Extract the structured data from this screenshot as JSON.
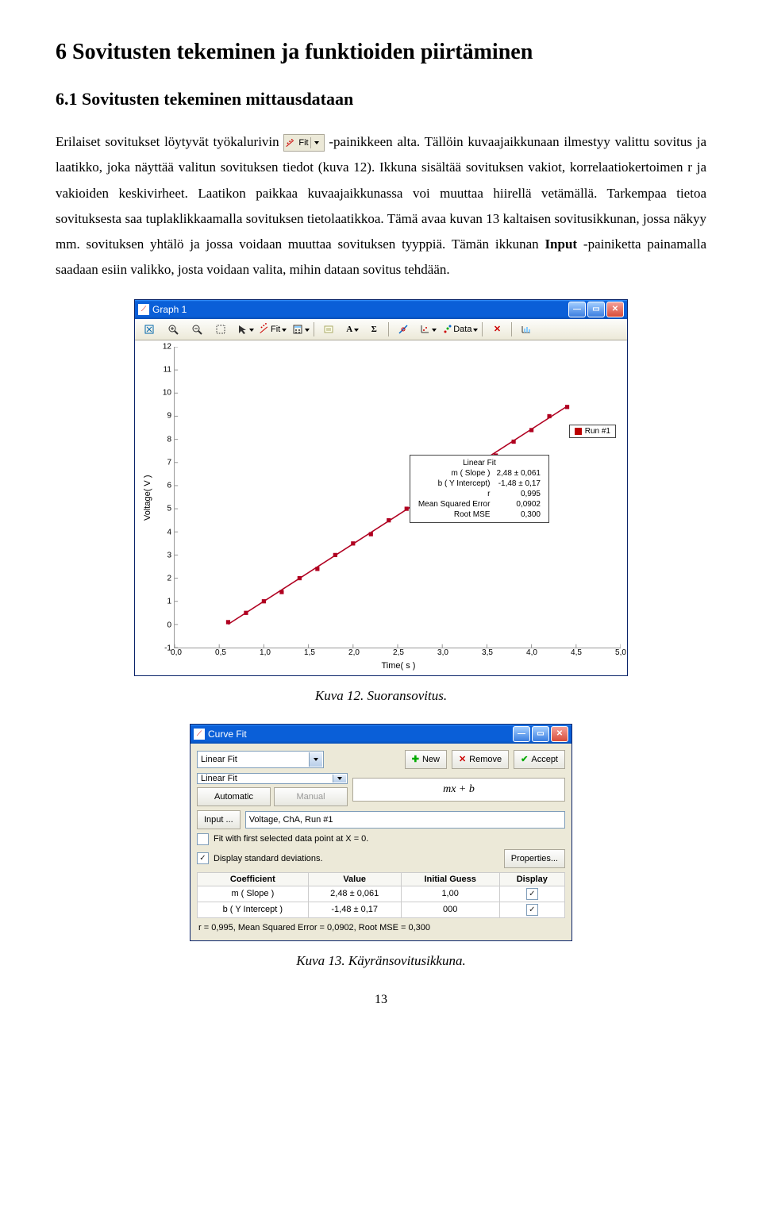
{
  "heading1": "6  Sovitusten tekeminen ja funktioiden piirtäminen",
  "heading2": "6.1  Sovitusten tekeminen mittausdataan",
  "para1a": "Erilaiset sovitukset löytyvät työkalurivin ",
  "fit_btn_label": "Fit",
  "para1b": "-painikkeen alta. Tällöin kuvaajaikkunaan ilmestyy valittu sovitus ja laatikko, joka näyttää valitun sovituksen tiedot (kuva 12). Ikkuna sisältää sovituksen vakiot, korrelaatiokertoimen r ja vakioiden keskivirheet. Laatikon paikkaa kuvaajaikkunassa voi muuttaa hiirellä vetämällä. Tarkempaa tietoa sovituksesta saa tuplaklikkaamalla sovituksen tietolaatikkoa. Tämä avaa kuvan 13 kaltaisen sovitusikkunan, jossa näkyy mm. sovituksen yhtälö ja jossa voidaan muuttaa sovituksen tyyppiä. Tämän ikkunan ",
  "input_bold": "Input",
  "para1c": "-painiketta painamalla saadaan esiin valikko, josta voidaan valita, mihin dataan sovitus tehdään.",
  "graph": {
    "title": "Graph 1",
    "toolbar": {
      "fit_label": "Fit",
      "data_label": "Data"
    },
    "ylabel": "Voltage( V )",
    "xlabel": "Time( s )",
    "legend": "Run #1",
    "info": {
      "title": "Linear Fit",
      "rows": [
        [
          "m ( Slope )",
          "2,48 ± 0,061"
        ],
        [
          "b ( Y Intercept)",
          "-1,48 ±  0,17"
        ],
        [
          "r",
          "0,995"
        ],
        [
          "Mean Squared Error",
          "0,0902"
        ],
        [
          "Root MSE",
          "0,300"
        ]
      ]
    }
  },
  "chart_data": {
    "type": "scatter",
    "title": "Graph 1",
    "xlabel": "Time( s )",
    "ylabel": "Voltage( V )",
    "xlim": [
      0.0,
      5.0
    ],
    "ylim": [
      -1,
      12
    ],
    "xticks": [
      "0,0",
      "0,5",
      "1,0",
      "1,5",
      "2,0",
      "2,5",
      "3,0",
      "3,5",
      "4,0",
      "4,5",
      "5,0"
    ],
    "yticks": [
      -1,
      0,
      1,
      2,
      3,
      4,
      5,
      6,
      7,
      8,
      9,
      10,
      11,
      12
    ],
    "series": [
      {
        "name": "Run #1",
        "x": [
          0.6,
          0.8,
          1.0,
          1.2,
          1.4,
          1.6,
          1.8,
          2.0,
          2.2,
          2.4,
          2.6,
          2.8,
          3.0,
          3.2,
          3.4,
          3.6,
          3.8,
          4.0,
          4.2,
          4.4
        ],
        "y": [
          0.1,
          0.5,
          1.0,
          1.4,
          2.0,
          2.4,
          3.0,
          3.5,
          3.9,
          4.5,
          5.0,
          5.4,
          5.9,
          6.4,
          7.0,
          7.3,
          7.9,
          8.4,
          9.0,
          9.4
        ]
      }
    ],
    "fit": {
      "type": "linear",
      "m": 2.48,
      "b": -1.48
    }
  },
  "caption1": "Kuva 12. Suoransovitus.",
  "curvefit": {
    "title": "Curve Fit",
    "type1": "Linear Fit",
    "type2": "Linear Fit",
    "new": "New",
    "remove": "Remove",
    "accept": "Accept",
    "automatic": "Automatic",
    "manual": "Manual",
    "formula": "mx + b",
    "input": "Input ...",
    "input_val": "Voltage, ChA, Run #1",
    "chk1": "Fit with first selected data point at X = 0.",
    "chk2": "Display standard deviations.",
    "properties": "Properties...",
    "th": [
      "Coefficient",
      "Value",
      "Initial Guess",
      "Display"
    ],
    "rows": [
      [
        "m ( Slope )",
        "2,48 ± 0,061",
        "1,00",
        "✓"
      ],
      [
        "b ( Y Intercept )",
        "-1,48 ± 0,17",
        "000",
        "✓"
      ]
    ],
    "status": "r = 0,995, Mean Squared Error = 0,0902, Root MSE = 0,300"
  },
  "caption2": "Kuva 13. Käyränsovitusikkuna.",
  "page_num": "13"
}
